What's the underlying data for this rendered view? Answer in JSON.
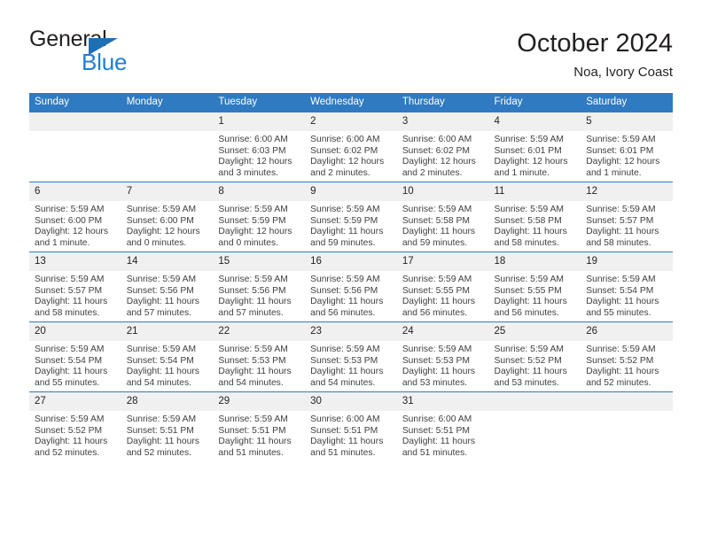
{
  "brand": {
    "name_part1": "General",
    "name_part2": "Blue",
    "triangle_color": "#1f6fb5",
    "blue_color": "#1f7fd0"
  },
  "header": {
    "month_title": "October 2024",
    "location": "Noa, Ivory Coast"
  },
  "theme": {
    "header_blue": "#2f7ac0",
    "daynum_band": "#f0f0f0",
    "text": "#231f20",
    "detail_text": "#404040"
  },
  "weekdays": [
    "Sunday",
    "Monday",
    "Tuesday",
    "Wednesday",
    "Thursday",
    "Friday",
    "Saturday"
  ],
  "weeks": [
    [
      {
        "day": "",
        "sunrise": "",
        "sunset": "",
        "daylight1": "",
        "daylight2": ""
      },
      {
        "day": "",
        "sunrise": "",
        "sunset": "",
        "daylight1": "",
        "daylight2": ""
      },
      {
        "day": "1",
        "sunrise": "Sunrise: 6:00 AM",
        "sunset": "Sunset: 6:03 PM",
        "daylight1": "Daylight: 12 hours",
        "daylight2": "and 3 minutes."
      },
      {
        "day": "2",
        "sunrise": "Sunrise: 6:00 AM",
        "sunset": "Sunset: 6:02 PM",
        "daylight1": "Daylight: 12 hours",
        "daylight2": "and 2 minutes."
      },
      {
        "day": "3",
        "sunrise": "Sunrise: 6:00 AM",
        "sunset": "Sunset: 6:02 PM",
        "daylight1": "Daylight: 12 hours",
        "daylight2": "and 2 minutes."
      },
      {
        "day": "4",
        "sunrise": "Sunrise: 5:59 AM",
        "sunset": "Sunset: 6:01 PM",
        "daylight1": "Daylight: 12 hours",
        "daylight2": "and 1 minute."
      },
      {
        "day": "5",
        "sunrise": "Sunrise: 5:59 AM",
        "sunset": "Sunset: 6:01 PM",
        "daylight1": "Daylight: 12 hours",
        "daylight2": "and 1 minute."
      }
    ],
    [
      {
        "day": "6",
        "sunrise": "Sunrise: 5:59 AM",
        "sunset": "Sunset: 6:00 PM",
        "daylight1": "Daylight: 12 hours",
        "daylight2": "and 1 minute."
      },
      {
        "day": "7",
        "sunrise": "Sunrise: 5:59 AM",
        "sunset": "Sunset: 6:00 PM",
        "daylight1": "Daylight: 12 hours",
        "daylight2": "and 0 minutes."
      },
      {
        "day": "8",
        "sunrise": "Sunrise: 5:59 AM",
        "sunset": "Sunset: 5:59 PM",
        "daylight1": "Daylight: 12 hours",
        "daylight2": "and 0 minutes."
      },
      {
        "day": "9",
        "sunrise": "Sunrise: 5:59 AM",
        "sunset": "Sunset: 5:59 PM",
        "daylight1": "Daylight: 11 hours",
        "daylight2": "and 59 minutes."
      },
      {
        "day": "10",
        "sunrise": "Sunrise: 5:59 AM",
        "sunset": "Sunset: 5:58 PM",
        "daylight1": "Daylight: 11 hours",
        "daylight2": "and 59 minutes."
      },
      {
        "day": "11",
        "sunrise": "Sunrise: 5:59 AM",
        "sunset": "Sunset: 5:58 PM",
        "daylight1": "Daylight: 11 hours",
        "daylight2": "and 58 minutes."
      },
      {
        "day": "12",
        "sunrise": "Sunrise: 5:59 AM",
        "sunset": "Sunset: 5:57 PM",
        "daylight1": "Daylight: 11 hours",
        "daylight2": "and 58 minutes."
      }
    ],
    [
      {
        "day": "13",
        "sunrise": "Sunrise: 5:59 AM",
        "sunset": "Sunset: 5:57 PM",
        "daylight1": "Daylight: 11 hours",
        "daylight2": "and 58 minutes."
      },
      {
        "day": "14",
        "sunrise": "Sunrise: 5:59 AM",
        "sunset": "Sunset: 5:56 PM",
        "daylight1": "Daylight: 11 hours",
        "daylight2": "and 57 minutes."
      },
      {
        "day": "15",
        "sunrise": "Sunrise: 5:59 AM",
        "sunset": "Sunset: 5:56 PM",
        "daylight1": "Daylight: 11 hours",
        "daylight2": "and 57 minutes."
      },
      {
        "day": "16",
        "sunrise": "Sunrise: 5:59 AM",
        "sunset": "Sunset: 5:56 PM",
        "daylight1": "Daylight: 11 hours",
        "daylight2": "and 56 minutes."
      },
      {
        "day": "17",
        "sunrise": "Sunrise: 5:59 AM",
        "sunset": "Sunset: 5:55 PM",
        "daylight1": "Daylight: 11 hours",
        "daylight2": "and 56 minutes."
      },
      {
        "day": "18",
        "sunrise": "Sunrise: 5:59 AM",
        "sunset": "Sunset: 5:55 PM",
        "daylight1": "Daylight: 11 hours",
        "daylight2": "and 56 minutes."
      },
      {
        "day": "19",
        "sunrise": "Sunrise: 5:59 AM",
        "sunset": "Sunset: 5:54 PM",
        "daylight1": "Daylight: 11 hours",
        "daylight2": "and 55 minutes."
      }
    ],
    [
      {
        "day": "20",
        "sunrise": "Sunrise: 5:59 AM",
        "sunset": "Sunset: 5:54 PM",
        "daylight1": "Daylight: 11 hours",
        "daylight2": "and 55 minutes."
      },
      {
        "day": "21",
        "sunrise": "Sunrise: 5:59 AM",
        "sunset": "Sunset: 5:54 PM",
        "daylight1": "Daylight: 11 hours",
        "daylight2": "and 54 minutes."
      },
      {
        "day": "22",
        "sunrise": "Sunrise: 5:59 AM",
        "sunset": "Sunset: 5:53 PM",
        "daylight1": "Daylight: 11 hours",
        "daylight2": "and 54 minutes."
      },
      {
        "day": "23",
        "sunrise": "Sunrise: 5:59 AM",
        "sunset": "Sunset: 5:53 PM",
        "daylight1": "Daylight: 11 hours",
        "daylight2": "and 54 minutes."
      },
      {
        "day": "24",
        "sunrise": "Sunrise: 5:59 AM",
        "sunset": "Sunset: 5:53 PM",
        "daylight1": "Daylight: 11 hours",
        "daylight2": "and 53 minutes."
      },
      {
        "day": "25",
        "sunrise": "Sunrise: 5:59 AM",
        "sunset": "Sunset: 5:52 PM",
        "daylight1": "Daylight: 11 hours",
        "daylight2": "and 53 minutes."
      },
      {
        "day": "26",
        "sunrise": "Sunrise: 5:59 AM",
        "sunset": "Sunset: 5:52 PM",
        "daylight1": "Daylight: 11 hours",
        "daylight2": "and 52 minutes."
      }
    ],
    [
      {
        "day": "27",
        "sunrise": "Sunrise: 5:59 AM",
        "sunset": "Sunset: 5:52 PM",
        "daylight1": "Daylight: 11 hours",
        "daylight2": "and 52 minutes."
      },
      {
        "day": "28",
        "sunrise": "Sunrise: 5:59 AM",
        "sunset": "Sunset: 5:51 PM",
        "daylight1": "Daylight: 11 hours",
        "daylight2": "and 52 minutes."
      },
      {
        "day": "29",
        "sunrise": "Sunrise: 5:59 AM",
        "sunset": "Sunset: 5:51 PM",
        "daylight1": "Daylight: 11 hours",
        "daylight2": "and 51 minutes."
      },
      {
        "day": "30",
        "sunrise": "Sunrise: 6:00 AM",
        "sunset": "Sunset: 5:51 PM",
        "daylight1": "Daylight: 11 hours",
        "daylight2": "and 51 minutes."
      },
      {
        "day": "31",
        "sunrise": "Sunrise: 6:00 AM",
        "sunset": "Sunset: 5:51 PM",
        "daylight1": "Daylight: 11 hours",
        "daylight2": "and 51 minutes."
      },
      {
        "day": "",
        "sunrise": "",
        "sunset": "",
        "daylight1": "",
        "daylight2": ""
      },
      {
        "day": "",
        "sunrise": "",
        "sunset": "",
        "daylight1": "",
        "daylight2": ""
      }
    ]
  ]
}
